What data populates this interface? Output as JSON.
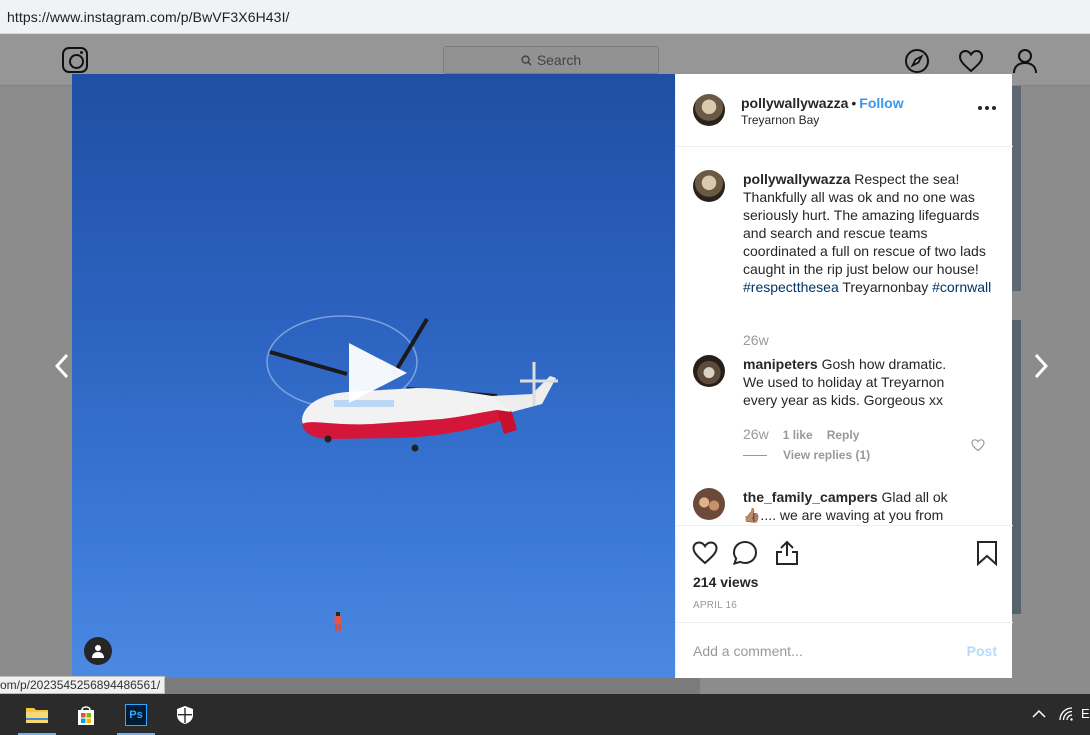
{
  "browser": {
    "url": "https://www.instagram.com/p/BwVF3X6H43I/"
  },
  "instagram": {
    "search_placeholder": "Search",
    "nav_icons": [
      "explore-compass-icon",
      "activity-heart-icon",
      "profile-icon"
    ]
  },
  "post": {
    "owner": "pollywallywazza",
    "separator": "•",
    "follow_label": "Follow",
    "location": "Treyarnon Bay",
    "caption": {
      "username": "pollywallywazza",
      "text": "Respect the sea! Thankfully all was ok and no one was seriously hurt. The amazing lifeguards and search and rescue teams coordinated a full on rescue of two lads caught in the rip just below our house!",
      "hashtag1": "#respectthesea",
      "mid_text": "Treyarnonbay",
      "hashtag2": "#cornwall",
      "age": "26w"
    },
    "comments": [
      {
        "username": "manipeters",
        "text": "Gosh how dramatic. We used to holiday at Treyarnon every year as kids. Gorgeous xx",
        "age": "26w",
        "likes": "1 like",
        "reply_label": "Reply",
        "view_replies": "View replies (1)"
      },
      {
        "username": "the_family_campers",
        "text": "Glad all ok 👍🏽.... we are waving at you from"
      }
    ],
    "views": "214 views",
    "date": "APRIL 16",
    "add_comment_placeholder": "Add a comment...",
    "post_label": "Post"
  },
  "status_link": "om/p/2023545256894486561/",
  "taskbar": {
    "apps": [
      "file-explorer-icon",
      "microsoft-store-icon",
      "photoshop-icon",
      "windows-security-icon"
    ],
    "photoshop_label": "Ps",
    "tray_text": "E"
  },
  "colors": {
    "accent": "#3897f0",
    "hashtag": "#003569",
    "sky_top": "#1f4fa3",
    "sky_bottom": "#4b89e3"
  }
}
